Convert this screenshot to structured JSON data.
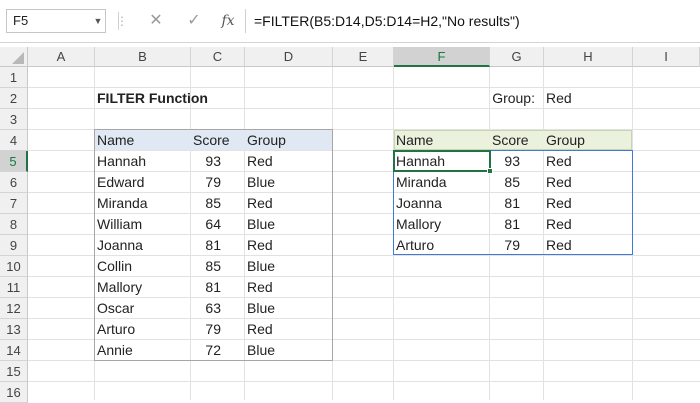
{
  "formula_bar": {
    "name_box": "F5",
    "formula": "=FILTER(B5:D14,D5:D14=H2,\"No results\")",
    "icons": [
      "chevron-down-icon",
      "more-icon",
      "cancel-icon",
      "enter-icon",
      "function-icon"
    ]
  },
  "columns": [
    "A",
    "B",
    "C",
    "D",
    "E",
    "F",
    "G",
    "H",
    "I"
  ],
  "rows": [
    "1",
    "2",
    "3",
    "4",
    "5",
    "6",
    "7",
    "8",
    "9",
    "10",
    "11",
    "12",
    "13",
    "14",
    "15",
    "16"
  ],
  "selected": {
    "column": "F",
    "row": "5"
  },
  "sheet": {
    "title": "FILTER Function",
    "criteria_label": "Group:",
    "criteria_value": "Red"
  },
  "source_table": {
    "headers": [
      "Name",
      "Score",
      "Group"
    ],
    "rows": [
      [
        "Hannah",
        "93",
        "Red"
      ],
      [
        "Edward",
        "79",
        "Blue"
      ],
      [
        "Miranda",
        "85",
        "Red"
      ],
      [
        "William",
        "64",
        "Blue"
      ],
      [
        "Joanna",
        "81",
        "Red"
      ],
      [
        "Collin",
        "85",
        "Blue"
      ],
      [
        "Mallory",
        "81",
        "Red"
      ],
      [
        "Oscar",
        "63",
        "Blue"
      ],
      [
        "Arturo",
        "79",
        "Red"
      ],
      [
        "Annie",
        "72",
        "Blue"
      ]
    ]
  },
  "result_table": {
    "headers": [
      "Name",
      "Score",
      "Group"
    ],
    "rows": [
      [
        "Hannah",
        "93",
        "Red"
      ],
      [
        "Miranda",
        "85",
        "Red"
      ],
      [
        "Joanna",
        "81",
        "Red"
      ],
      [
        "Mallory",
        "81",
        "Red"
      ],
      [
        "Arturo",
        "79",
        "Red"
      ]
    ]
  },
  "colors": {
    "selection": "#217346",
    "source_header": "#dfe8f3",
    "result_header": "#eaf1dd",
    "spill_border": "#3f7ad6"
  }
}
